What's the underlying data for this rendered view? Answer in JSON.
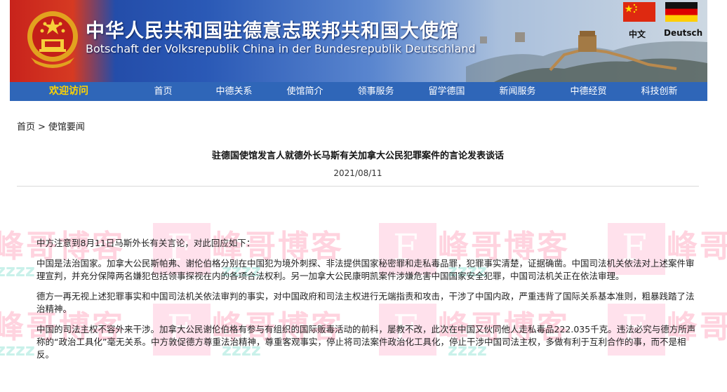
{
  "header": {
    "title_zh": "中华人民共和国驻德意志联邦共和国大使馆",
    "title_de": "Botschaft der Volksrepublik China in der Bundesrepublik Deutschland",
    "lang_zh": "中文",
    "lang_de": "Deutsch"
  },
  "nav": {
    "items": [
      "欢迎访问",
      "首页",
      "中德关系",
      "使馆简介",
      "领事服务",
      "留学德国",
      "新闻服务",
      "中德经贸",
      "科技创新"
    ]
  },
  "breadcrumb": {
    "home": "首页",
    "separator": ">",
    "section": "使馆要闻"
  },
  "article": {
    "title": "驻德国使馆发言人就德外长马斯有关加拿大公民犯罪案件的言论发表谈话",
    "date": "2021/08/11",
    "paragraphs": [
      "中方注意到8月11日马斯外长有关言论，对此回应如下：",
      "中国是法治国家。加拿大公民斯帕弗、谢伦伯格分别在中国犯为境外刺探、非法提供国家秘密罪和走私毒品罪，犯罪事实清楚，证据确凿。中国司法机关依法对上述案件审理宣判，并充分保障两名嫌犯包括领事探视在内的各项合法权利。另一加拿大公民康明凯案件涉嫌危害中国国家安全犯罪，中国司法机关正在依法审理。",
      "德方一再无视上述犯罪事实和中国司法机关依法审判的事实，对中国政府和司法主权进行无端指责和攻击，干涉了中国内政，严重违背了国际关系基本准则，粗暴践踏了法治精神。",
      "中国的司法主权不容外来干涉。加拿大公民谢伦伯格有参与有组织的国际贩毒活动的前科，屡教不改，此次在中国又伙同他人走私毒品222.035千克。违法必究与德方所声称的“政治工具化”毫无关系。中方敦促德方尊重法治精神，尊重客观事实，停止将司法案件政治化工具化，停止干涉中国司法主权，多做有利于互利合作的事，而不是相反。"
    ]
  },
  "watermark": {
    "text": "峰哥博客",
    "letter": "F",
    "sub": "zzzz"
  },
  "colors": {
    "nav_bg": "#2f66b8",
    "nav_welcome": "#ffd400",
    "banner_red": "#c8231c",
    "banner_blue": "#1d3f9a"
  }
}
